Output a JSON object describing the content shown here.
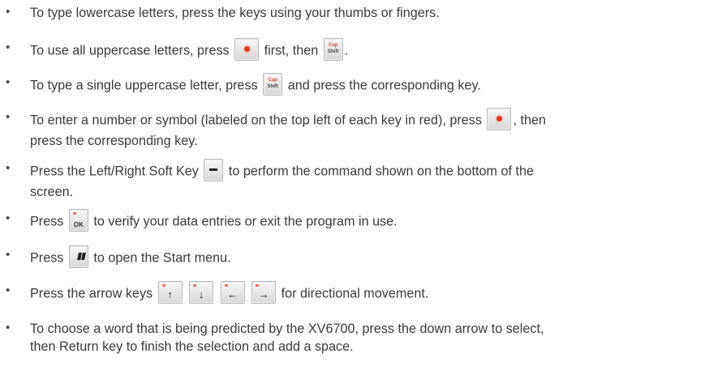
{
  "bullet_symbol": "•",
  "items": [
    {
      "text": "To type lowercase letters, press the keys using your thumbs or fingers."
    },
    {
      "a": "To use all uppercase letters, press",
      "b": "first, then",
      "c": "."
    },
    {
      "a": "To type a single uppercase letter, press",
      "b": "and press the corresponding key."
    },
    {
      "a": "To enter a number or symbol (labeled on the top left of each key in red), press",
      "b": ", then",
      "c": "press the corresponding key."
    },
    {
      "a": "Press the Left/Right Soft Key",
      "b": "to perform the command shown on the bottom of the",
      "c": "screen."
    },
    {
      "a": "Press",
      "b": "to verify your data entries or exit the program in use."
    },
    {
      "a": "Press",
      "b": "to open the Start menu."
    },
    {
      "a": "Press the arrow keys",
      "b": "for directional movement."
    },
    {
      "a": "To choose a word that is being predicted by the XV6700, press the down arrow to select,",
      "b": "then Return key to finish the selection and add a space."
    }
  ],
  "keys": {
    "cap_label": "Cap",
    "shift_label": "Shift",
    "ok_label": "OK",
    "up_arrow": "↑",
    "down_arrow": "↓",
    "left_arrow": "←",
    "right_arrow": "→"
  },
  "icons": {
    "function_key": "function-key-icon",
    "cap_shift_key": "cap-shift-key-icon",
    "soft_key": "soft-key-icon",
    "ok_key": "ok-key-icon",
    "start_key": "windows-start-key-icon",
    "arrow_keys": "arrow-key-icon"
  },
  "colors": {
    "text": "#3a3a3a",
    "function_dot": "#e33c1c",
    "key_top_label": "#e14b2c"
  }
}
